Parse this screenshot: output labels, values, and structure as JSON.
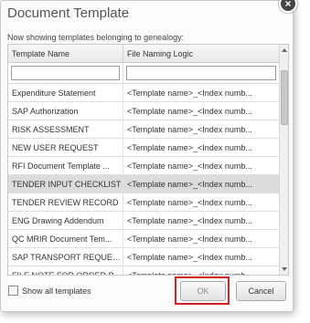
{
  "dialog": {
    "title": "Document Template",
    "close_label": "×",
    "subtitle": "Now showing templates belonging to genealogy:"
  },
  "grid": {
    "columns": [
      "Template Name",
      "File Naming Logic"
    ],
    "rows": [
      {
        "name": "Expenditure Statement",
        "logic": "<Template name>_<Index numb..."
      },
      {
        "name": "SAP Authorization",
        "logic": "<Template name>_<Index numb..."
      },
      {
        "name": "RISK ASSESSMENT",
        "logic": "<Template name>_<Index numb..."
      },
      {
        "name": "NEW USER REQUEST",
        "logic": "<Template name>_<Index numb..."
      },
      {
        "name": "RFI Document Template ...",
        "logic": "<Template name>_<Index numb..."
      },
      {
        "name": "TENDER INPUT CHECKLIST",
        "logic": "<Template name>_<Index numb...",
        "selected": true
      },
      {
        "name": "TENDER REVIEW RECORD",
        "logic": "<Template name>_<Index numb..."
      },
      {
        "name": "ENG Drawing Addendum",
        "logic": "<Template name>_<Index numb..."
      },
      {
        "name": "QC MRIR Document Tem...",
        "logic": "<Template name>_<Index numb..."
      },
      {
        "name": "SAP TRANSPORT REQUEST",
        "logic": "<Template name>_<Index numb..."
      },
      {
        "name": "FILE NOTE FOR ORDER P...",
        "logic": "<Template name>_<Index numb..."
      }
    ]
  },
  "footer": {
    "show_all_label": "Show all templates",
    "ok_label": "OK",
    "cancel_label": "Cancel"
  },
  "colors": {
    "selected_row": "#dcdcdc",
    "highlight_border": "#d62020"
  }
}
